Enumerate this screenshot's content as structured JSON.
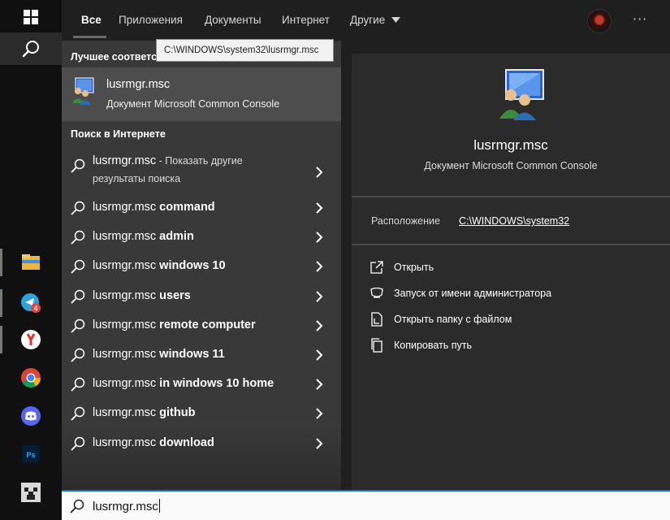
{
  "tabs": [
    "Все",
    "Приложения",
    "Документы",
    "Интернет",
    "Другие"
  ],
  "tabs_more_icon": "chevron-down-icon",
  "more_label": "···",
  "best_match": {
    "heading": "Лучшее соответствие",
    "title": "lusrmgr.msc",
    "subtitle": "Документ Microsoft Common Console",
    "tooltip": "C:\\WINDOWS\\system32\\lusrmgr.msc"
  },
  "web": {
    "heading": "Поиск в Интернете",
    "first": {
      "query": "lusrmgr.msc",
      "suffix": " - Показать другие",
      "line2": "результаты поиска"
    },
    "suggestions": [
      {
        "base": "lusrmgr.msc ",
        "bold": "command"
      },
      {
        "base": "lusrmgr.msc ",
        "bold": "admin"
      },
      {
        "base": "lusrmgr.msc ",
        "bold": "windows 10"
      },
      {
        "base": "lusrmgr.msc ",
        "bold": "users"
      },
      {
        "base": "lusrmgr.msc ",
        "bold": "remote computer"
      },
      {
        "base": "lusrmgr.msc ",
        "bold": "windows 11"
      },
      {
        "base": "lusrmgr.msc ",
        "bold": "in windows 10 home"
      },
      {
        "base": "lusrmgr.msc ",
        "bold": "github"
      },
      {
        "base": "lusrmgr.msc ",
        "bold": "download"
      }
    ]
  },
  "detail": {
    "title": "lusrmgr.msc",
    "subtitle": "Документ Microsoft Common Console",
    "location_label": "Расположение",
    "location_value": "C:\\WINDOWS\\system32",
    "actions": [
      {
        "label": "Открыть",
        "icon": "open-icon"
      },
      {
        "label": "Запуск от имени администратора",
        "icon": "shield-icon"
      },
      {
        "label": "Открыть папку с файлом",
        "icon": "file-location-icon"
      },
      {
        "label": "Копировать путь",
        "icon": "copy-icon"
      }
    ]
  },
  "search": {
    "value": "lusrmgr.msc"
  },
  "taskbar": {
    "apps": [
      "file-explorer-icon",
      "telegram-icon",
      "yandex-browser-icon",
      "chrome-icon",
      "discord-icon",
      "photoshop-icon",
      "minecraft-icon"
    ],
    "telegram_badge": "4"
  },
  "colors": {
    "accent": "#1a73c8",
    "pane": "#393939",
    "detail_pane": "#2b2b2b",
    "taskbar": "#101010"
  }
}
